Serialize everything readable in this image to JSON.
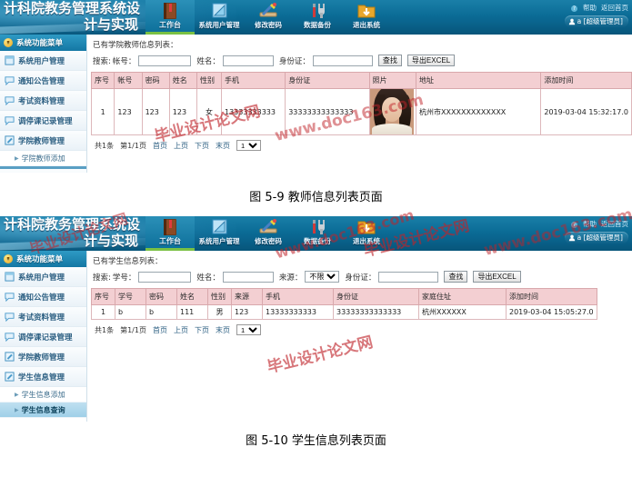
{
  "header": {
    "brand_line1": "计科院教务管理系统设",
    "brand_line2": "计与实现",
    "nav": [
      {
        "label": "工作台",
        "icon": "book-icon",
        "active": true
      },
      {
        "label": "系统用户管理",
        "icon": "ruler-triangle-icon",
        "active": false
      },
      {
        "label": "修改密码",
        "icon": "pencil-ruler-icon",
        "active": false
      },
      {
        "label": "数据备份",
        "icon": "screwdriver-wrench-icon",
        "active": false
      },
      {
        "label": "退出系统",
        "icon": "folder-download-icon",
        "active": false
      }
    ],
    "help_mark": "?",
    "help_label": "帮助",
    "home_label": "返回首页",
    "user_label": "a [超级管理员]"
  },
  "sidebar": {
    "title": "系统功能菜单",
    "items": [
      {
        "label": "系统用户管理",
        "icon": "window-icon"
      },
      {
        "label": "通知公告管理",
        "icon": "comment-icon"
      },
      {
        "label": "考试资料管理",
        "icon": "comment-icon"
      },
      {
        "label": "调停课记录管理",
        "icon": "comment-icon"
      },
      {
        "label": "学院教师管理",
        "icon": "edit-icon"
      },
      {
        "label": "学生信息管理",
        "icon": "edit-icon"
      }
    ],
    "sub_teacher_add": "学院教师添加",
    "sub_student_add": "学生信息添加",
    "sub_student_query": "学生信息查询"
  },
  "teacher_panel": {
    "list_title": "已有学院教师信息列表：",
    "search": {
      "prefix": "搜索:",
      "account_label": "帐号：",
      "account_value": "",
      "name_label": "姓名：",
      "name_value": "",
      "idcard_label": "身份证：",
      "idcard_value": "",
      "find_button": "查找",
      "export_button": "导出EXCEL"
    },
    "columns": [
      "序号",
      "帐号",
      "密码",
      "姓名",
      "性别",
      "手机",
      "身份证",
      "照片",
      "地址",
      "添加时间"
    ],
    "rows": [
      {
        "index": "1",
        "account": "123",
        "password": "123",
        "name": "123",
        "gender": "女",
        "phone": "13333333333",
        "idcard": "33333333333333",
        "photo": "female-portrait-photo",
        "address": "杭州市XXXXXXXXXXXXX",
        "added": "2019-03-04 15:32:17.0"
      }
    ],
    "pager": {
      "total": "共1条",
      "page": "第1/1页",
      "first": "首页",
      "prev": "上页",
      "next": "下页",
      "last": "末页",
      "jump_value": "1"
    }
  },
  "student_panel": {
    "list_title": "已有学生信息列表：",
    "search": {
      "prefix": "搜索:",
      "sno_label": "学号：",
      "sno_value": "",
      "name_label": "姓名：",
      "name_value": "",
      "source_label": "来源：",
      "source_value": "不限",
      "source_options": [
        "不限"
      ],
      "idcard_label": "身份证：",
      "idcard_value": "",
      "find_button": "查找",
      "export_button": "导出EXCEL"
    },
    "columns": [
      "序号",
      "学号",
      "密码",
      "姓名",
      "性别",
      "来源",
      "手机",
      "身份证",
      "家庭住址",
      "添加时间"
    ],
    "rows": [
      {
        "index": "1",
        "sno": "b",
        "password": "b",
        "name": "111",
        "gender": "男",
        "source": "123",
        "phone": "13333333333",
        "idcard": "33333333333333",
        "address": "杭州XXXXXX",
        "added": "2019-03-04 15:05:27.0"
      }
    ],
    "pager": {
      "total": "共1条",
      "page": "第1/1页",
      "first": "首页",
      "prev": "上页",
      "next": "下页",
      "last": "末页",
      "jump_value": "1"
    }
  },
  "captions": {
    "fig_5_9": "图 5-9 教师信息列表页面",
    "fig_5_10": "图 5-10 学生信息列表页面"
  },
  "watermarks": {
    "cn": "毕业设计论文网",
    "url": "www.doc163.com"
  },
  "colors": {
    "header_blue": "#0b6c96",
    "active_tab_underline": "#7ac143",
    "sidebar_title": "#1477a4",
    "table_header_pink": "#f3cfd2",
    "watermark_red": "#c0232a"
  }
}
